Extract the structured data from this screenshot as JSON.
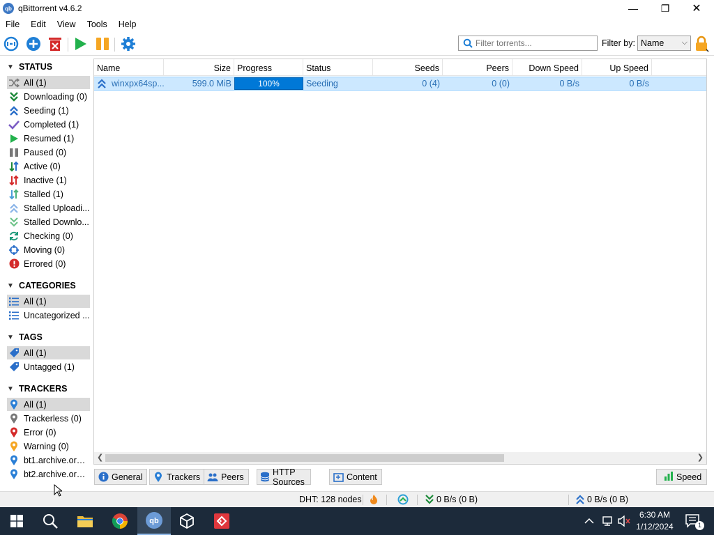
{
  "window": {
    "title": "qBittorrent v4.6.2",
    "app_icon_text": "qb",
    "minimize": "—",
    "maximize": "❐",
    "close": "✕"
  },
  "menu": [
    "File",
    "Edit",
    "View",
    "Tools",
    "Help"
  ],
  "toolbar": {
    "icons": [
      "add-link-icon",
      "add-torrent-icon",
      "delete-icon",
      "resume-icon",
      "pause-icon",
      "options-icon"
    ],
    "filter_placeholder": "Filter torrents...",
    "filter_by_label": "Filter by:",
    "filter_by_value": "Name"
  },
  "sidebar": {
    "status": {
      "title": "STATUS",
      "items": [
        {
          "label": "All (1)",
          "icon": "shuffle-icon",
          "selected": true
        },
        {
          "label": "Downloading (0)",
          "icon": "downloading-icon"
        },
        {
          "label": "Seeding (1)",
          "icon": "seeding-icon"
        },
        {
          "label": "Completed (1)",
          "icon": "checkmark-icon"
        },
        {
          "label": "Resumed (1)",
          "icon": "play-icon"
        },
        {
          "label": "Paused (0)",
          "icon": "pause-icon"
        },
        {
          "label": "Active (0)",
          "icon": "active-icon"
        },
        {
          "label": "Inactive (1)",
          "icon": "inactive-icon"
        },
        {
          "label": "Stalled (1)",
          "icon": "stalled-icon"
        },
        {
          "label": "Stalled Uploadi...",
          "icon": "stalled-upload-icon"
        },
        {
          "label": "Stalled Downlo...",
          "icon": "stalled-download-icon"
        },
        {
          "label": "Checking (0)",
          "icon": "checking-icon"
        },
        {
          "label": "Moving (0)",
          "icon": "moving-icon"
        },
        {
          "label": "Errored (0)",
          "icon": "error-icon"
        }
      ]
    },
    "categories": {
      "title": "CATEGORIES",
      "items": [
        {
          "label": "All (1)",
          "icon": "list-icon",
          "selected": true
        },
        {
          "label": "Uncategorized ...",
          "icon": "list-icon"
        }
      ]
    },
    "tags": {
      "title": "TAGS",
      "items": [
        {
          "label": "All (1)",
          "icon": "tag-icon",
          "selected": true
        },
        {
          "label": "Untagged (1)",
          "icon": "tag-icon"
        }
      ]
    },
    "trackers": {
      "title": "TRACKERS",
      "items": [
        {
          "label": "All (1)",
          "icon": "pin-blue-icon",
          "selected": true
        },
        {
          "label": "Trackerless (0)",
          "icon": "pin-gray-icon"
        },
        {
          "label": "Error (0)",
          "icon": "pin-red-icon"
        },
        {
          "label": "Warning (0)",
          "icon": "pin-orange-icon"
        },
        {
          "label": "bt1.archive.org ...",
          "icon": "pin-blue-icon"
        },
        {
          "label": "bt2.archive.org ...",
          "icon": "pin-blue-icon"
        }
      ]
    }
  },
  "table": {
    "columns": [
      "Name",
      "Size",
      "Progress",
      "Status",
      "Seeds",
      "Peers",
      "Down Speed",
      "Up Speed"
    ],
    "rows": [
      {
        "name": "winxpx64sp...",
        "size": "599.0 MiB",
        "progress_text": "100%",
        "progress": 1.0,
        "status": "Seeding",
        "seeds": "0 (4)",
        "peers": "0 (0)",
        "down_speed": "0 B/s",
        "up_speed": "0 B/s"
      }
    ]
  },
  "bottom_tabs": [
    "General",
    "Trackers",
    "Peers",
    "HTTP Sources",
    "Content"
  ],
  "speed_button": "Speed",
  "statusbar": {
    "dht": "DHT: 128 nodes",
    "download": "0 B/s (0 B)",
    "upload": "0 B/s (0 B)"
  },
  "taskbar": {
    "time": "6:30 AM",
    "date": "1/12/2024",
    "notification_count": "1"
  },
  "colors": {
    "accent": "#0078d7",
    "selection": "#cce8ff",
    "row_text": "#2a6fb5",
    "taskbar": "#1c2a3a"
  }
}
